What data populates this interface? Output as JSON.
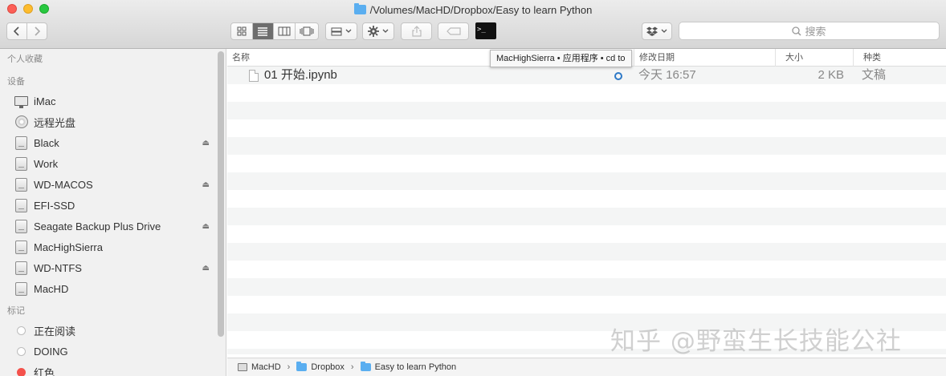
{
  "window": {
    "title": "/Volumes/MacHD/Dropbox/Easy to learn Python"
  },
  "toolbar": {
    "back_icon": "chevron-left-icon",
    "forward_icon": "chevron-right-icon",
    "terminal_label": ">_",
    "search_placeholder": "搜索"
  },
  "tooltip": "MacHighSierra • 应用程序 • cd to",
  "sidebar": {
    "favorites_label": "个人收藏",
    "devices_label": "设备",
    "devices": [
      {
        "label": "iMac",
        "icon": "monitor-icon",
        "eject": false
      },
      {
        "label": "远程光盘",
        "icon": "disc-icon",
        "eject": false
      },
      {
        "label": "Black",
        "icon": "drive-icon",
        "eject": true
      },
      {
        "label": "Work",
        "icon": "drive-icon",
        "eject": false
      },
      {
        "label": "WD-MACOS",
        "icon": "drive-icon",
        "eject": true
      },
      {
        "label": "EFI-SSD",
        "icon": "drive-icon",
        "eject": false
      },
      {
        "label": "Seagate Backup Plus Drive",
        "icon": "drive-icon",
        "eject": true
      },
      {
        "label": "MacHighSierra",
        "icon": "drive-icon",
        "eject": false
      },
      {
        "label": "WD-NTFS",
        "icon": "drive-icon",
        "eject": true
      },
      {
        "label": "MacHD",
        "icon": "drive-icon",
        "eject": false
      }
    ],
    "tags_label": "标记",
    "tags": [
      {
        "label": "正在阅读",
        "color": "#ffffff"
      },
      {
        "label": "DOING",
        "color": "#ffffff"
      },
      {
        "label": "红色",
        "color": "#f4524c"
      }
    ],
    "eject_glyph": "⏏"
  },
  "list": {
    "columns": {
      "name": "名称",
      "modified": "修改日期",
      "size": "大小",
      "kind": "种类"
    },
    "files": [
      {
        "name": "01 开始.ipynb",
        "modified": "今天 16:57",
        "size": "2 KB",
        "kind": "文稿"
      }
    ]
  },
  "pathbar": {
    "items": [
      "MacHD",
      "Dropbox",
      "Easy to learn Python"
    ],
    "separator": "›"
  },
  "watermark": "知乎 @野蛮生长技能公社"
}
